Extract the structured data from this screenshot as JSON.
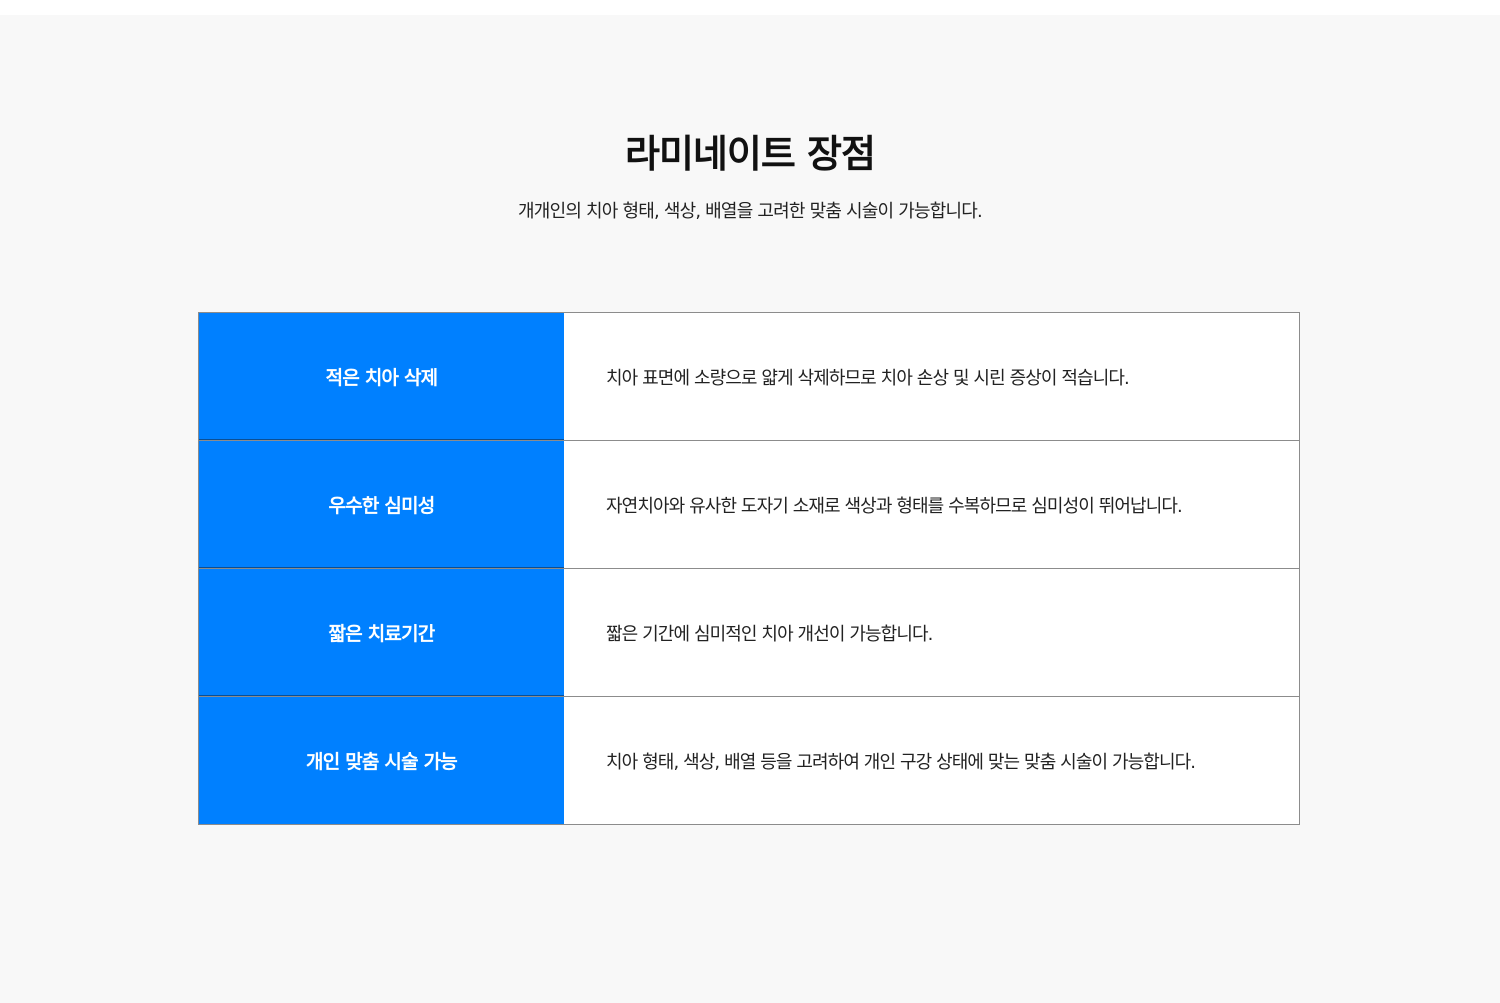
{
  "section": {
    "title": "라미네이트 장점",
    "subtitle": "개개인의 치아 형태, 색상, 배열을 고려한 맞춤 시술이 가능합니다."
  },
  "advantages": [
    {
      "label": "적은 치아 삭제",
      "description": "치아 표면에 소량으로 얇게 삭제하므로 치아 손상 및 시린 증상이 적습니다."
    },
    {
      "label": "우수한 심미성",
      "description": "자연치아와 유사한 도자기 소재로 색상과 형태를 수복하므로 심미성이 뛰어납니다."
    },
    {
      "label": "짧은 치료기간",
      "description": "짧은 기간에 심미적인 치아 개선이 가능합니다."
    },
    {
      "label": "개인 맞춤 시술 가능",
      "description": "치아 형태, 색상, 배열 등을 고려하여 개인 구강 상태에 맞는 맞춤 시술이 가능합니다."
    }
  ],
  "colors": {
    "accent": "#0080ff",
    "background": "#f8f8f8",
    "border": "#8c8c8c"
  }
}
